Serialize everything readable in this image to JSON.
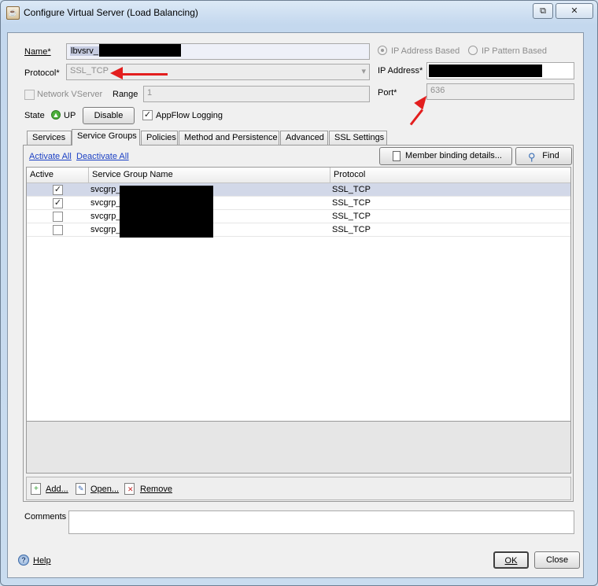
{
  "window": {
    "title": "Configure Virtual Server (Load Balancing)",
    "restore_glyph": "⧉",
    "close_glyph": "✕",
    "app_icon": "java-cup-icon"
  },
  "form": {
    "name_label": "Name*",
    "name_value": "lbvsrv_",
    "protocol_label": "Protocol*",
    "protocol_value": "SSL_TCP",
    "ip_address_based_label": "IP Address Based",
    "ip_pattern_based_label": "IP Pattern Based",
    "ip_address_label": "IP Address*",
    "network_vserver_label": "Network VServer",
    "range_label": "Range",
    "range_value": "1",
    "port_label": "Port*",
    "port_value": "636",
    "state_label": "State",
    "state_value": "UP",
    "disable_button": "Disable",
    "appflow_label": "AppFlow Logging",
    "appflow_checked": true,
    "status_color": "#4caf3a"
  },
  "tabs": [
    {
      "label": "Services"
    },
    {
      "label": "Service Groups"
    },
    {
      "label": "Policies"
    },
    {
      "label": "Method and Persistence"
    },
    {
      "label": "Advanced"
    },
    {
      "label": "SSL Settings"
    }
  ],
  "panel": {
    "activate_all": "Activate All",
    "deactivate_all": "Deactivate All",
    "member_binding_button": "Member binding details...",
    "find_button": "Find"
  },
  "table": {
    "columns": [
      "Active",
      "Service Group Name",
      "Protocol"
    ],
    "rows": [
      {
        "active": true,
        "name": "svcgrp_",
        "protocol": "SSL_TCP"
      },
      {
        "active": true,
        "name": "svcgrp_",
        "protocol": "SSL_TCP"
      },
      {
        "active": false,
        "name": "svcgrp_",
        "protocol": "SSL_TCP"
      },
      {
        "active": false,
        "name": "svcgrp_",
        "protocol": "SSL_TCP"
      }
    ]
  },
  "actions": {
    "add": "Add...",
    "open": "Open...",
    "remove": "Remove"
  },
  "comments_label": "Comments",
  "footer": {
    "help": "Help",
    "ok": "OK",
    "close": "Close"
  },
  "colors": {
    "annotation_arrow": "#e31e1e",
    "selected_row": "#d2d8e8",
    "link": "#1a3fc4"
  }
}
